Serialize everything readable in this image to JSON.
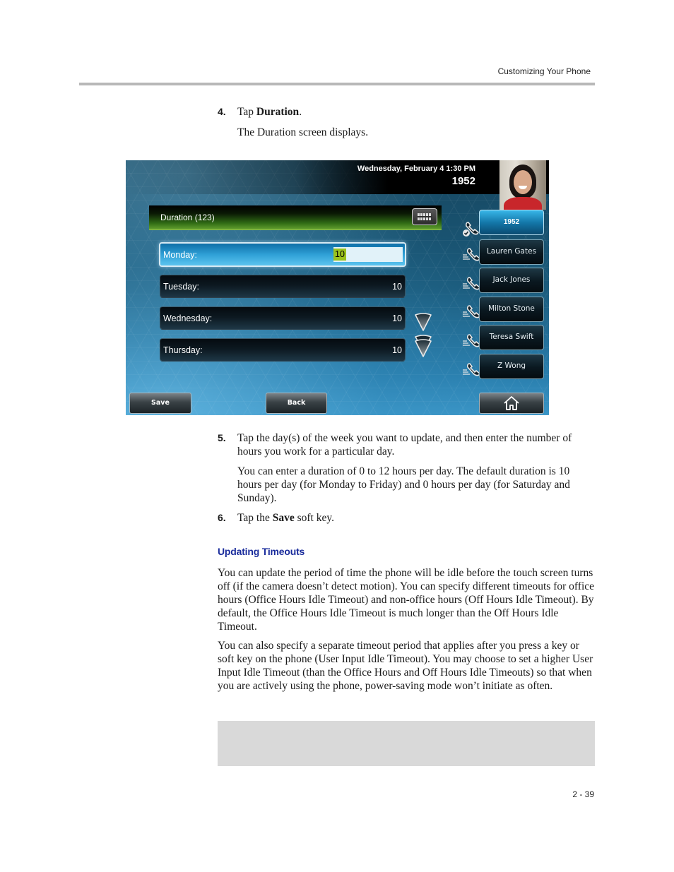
{
  "header": {
    "running_title": "Customizing Your Phone"
  },
  "steps": [
    {
      "number": "4.",
      "text_before": "Tap ",
      "bold": "Duration",
      "text_after": ".",
      "follow": "The Duration screen displays."
    },
    {
      "number": "5.",
      "text": "Tap the day(s) of the week you want to update, and then enter the number of hours you work for a particular day.",
      "follow": "You can enter a duration of 0 to 12 hours per day. The default duration is 10 hours per day (for Monday to Friday) and 0 hours per day (for Saturday and Sunday)."
    },
    {
      "number": "6.",
      "text_before": "Tap the ",
      "bold": "Save",
      "text_after": " soft key."
    }
  ],
  "phone_screen": {
    "status": {
      "datetime": "Wednesday, February 4  1:30 PM",
      "line_number": "1952"
    },
    "title": "Duration (123)",
    "keyboard_icon": "keyboard-icon",
    "fields": [
      {
        "label": "Monday:",
        "value": "10",
        "active": true
      },
      {
        "label": "Tuesday:",
        "value": "10"
      },
      {
        "label": "Wednesday:",
        "value": "10"
      },
      {
        "label": "Thursday:",
        "value": "10"
      }
    ],
    "line_keys": [
      {
        "label": "1952",
        "icon": "handset-registered-icon",
        "active": true
      },
      {
        "label": "Lauren Gates",
        "icon": "handset-speed-dial-icon"
      },
      {
        "label": "Jack Jones",
        "icon": "handset-speed-dial-icon"
      },
      {
        "label": "Milton Stone",
        "icon": "handset-speed-dial-icon"
      },
      {
        "label": "Teresa Swift",
        "icon": "handset-speed-dial-icon"
      },
      {
        "label": "Z Wong",
        "icon": "handset-speed-dial-icon"
      }
    ],
    "soft_keys": {
      "save": "Save",
      "back": "Back",
      "home_icon": "home-icon"
    },
    "colors": {
      "title_bar_green": "#5d9a2c",
      "active_field_blue": "#2fa0d6",
      "selection_green": "#9ac21d"
    }
  },
  "section": {
    "title": "Updating Timeouts",
    "paragraphs": [
      "You can update the period of time the phone will be idle before the touch screen turns off (if the camera doesn’t detect motion). You can specify different timeouts for office hours (Office Hours Idle Timeout) and non-office hours (Off Hours Idle Timeout). By default, the Office Hours Idle Timeout is much longer than the Off Hours Idle Timeout.",
      "You can also specify a separate timeout period that applies after you press a key or soft key on the phone (User Input Idle Timeout). You may choose to set a higher User Input Idle Timeout (than the Office Hours and Off Hours Idle Timeouts) so that when you are actively using the phone, power-saving mode won’t initiate as often."
    ]
  },
  "footer": {
    "page_number": "2 - 39"
  }
}
